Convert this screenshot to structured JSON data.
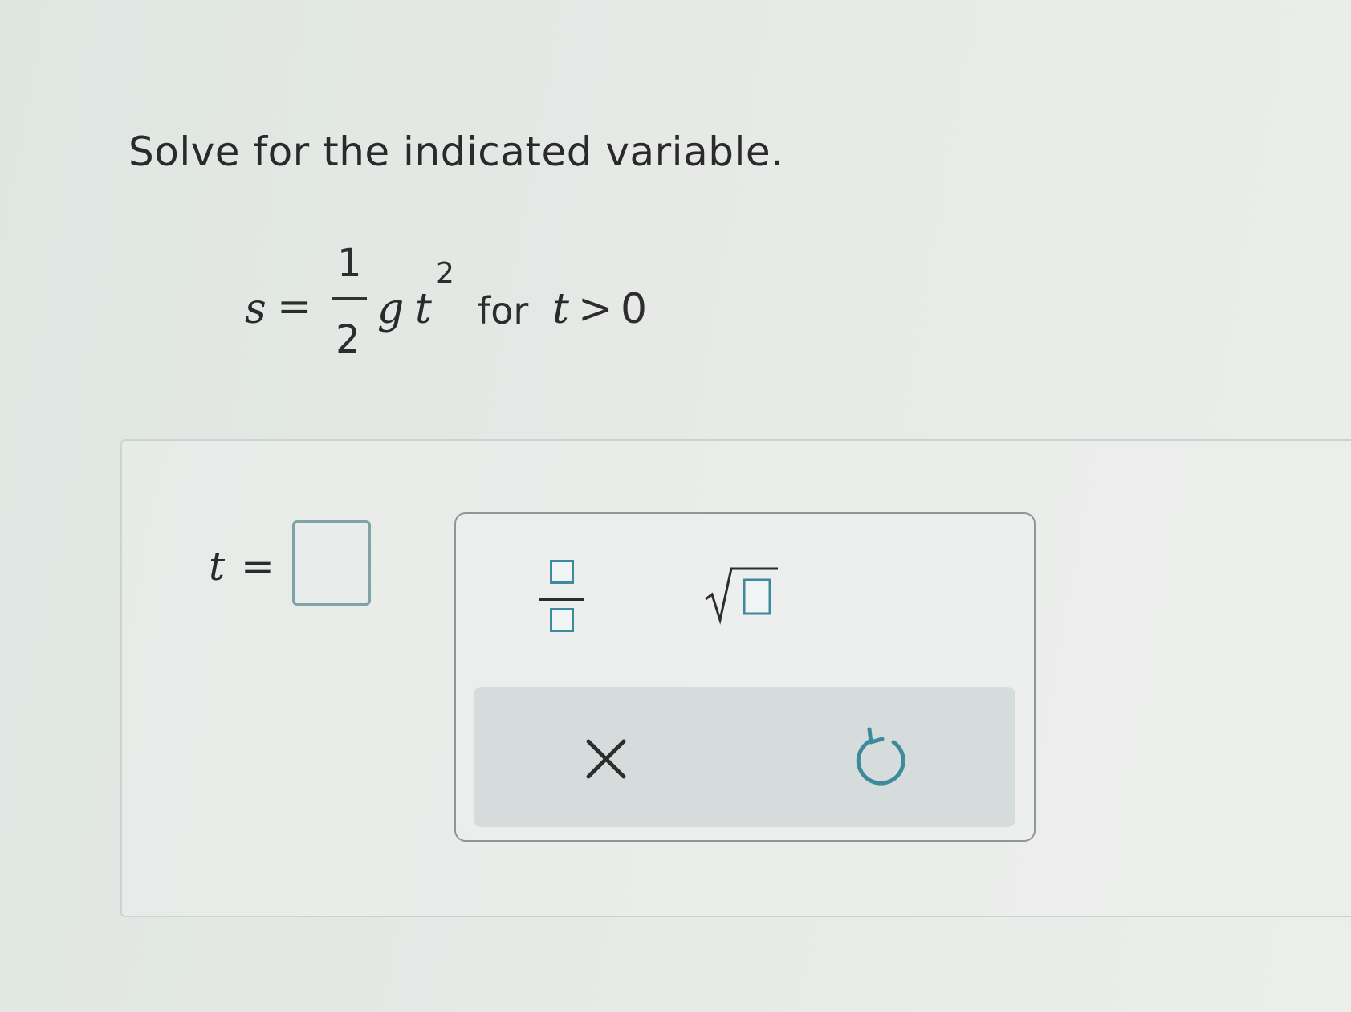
{
  "problem": {
    "instruction": "Solve for the indicated variable.",
    "equation": {
      "lhs_var": "s",
      "equals": "=",
      "fraction_numerator": "1",
      "fraction_denominator": "2",
      "factor_g": "g",
      "factor_t": "t",
      "exponent": "2",
      "condition_word": "for",
      "condition_var": "t",
      "condition_op": ">",
      "condition_value": "0"
    }
  },
  "answer": {
    "variable": "t",
    "equals": "=",
    "value": ""
  },
  "keypad": {
    "keys": [
      {
        "name": "fraction",
        "icon": "fraction-template-icon"
      },
      {
        "name": "square-root",
        "icon": "square-root-template-icon"
      }
    ],
    "actions": [
      {
        "name": "clear",
        "icon": "close-icon",
        "glyph": "×"
      },
      {
        "name": "undo",
        "icon": "undo-icon"
      }
    ]
  },
  "colors": {
    "accent": "#3c8a9c",
    "input_border": "#7fa3a7",
    "action_bar": "#d5dcdb",
    "text": "#2a2a2a"
  }
}
